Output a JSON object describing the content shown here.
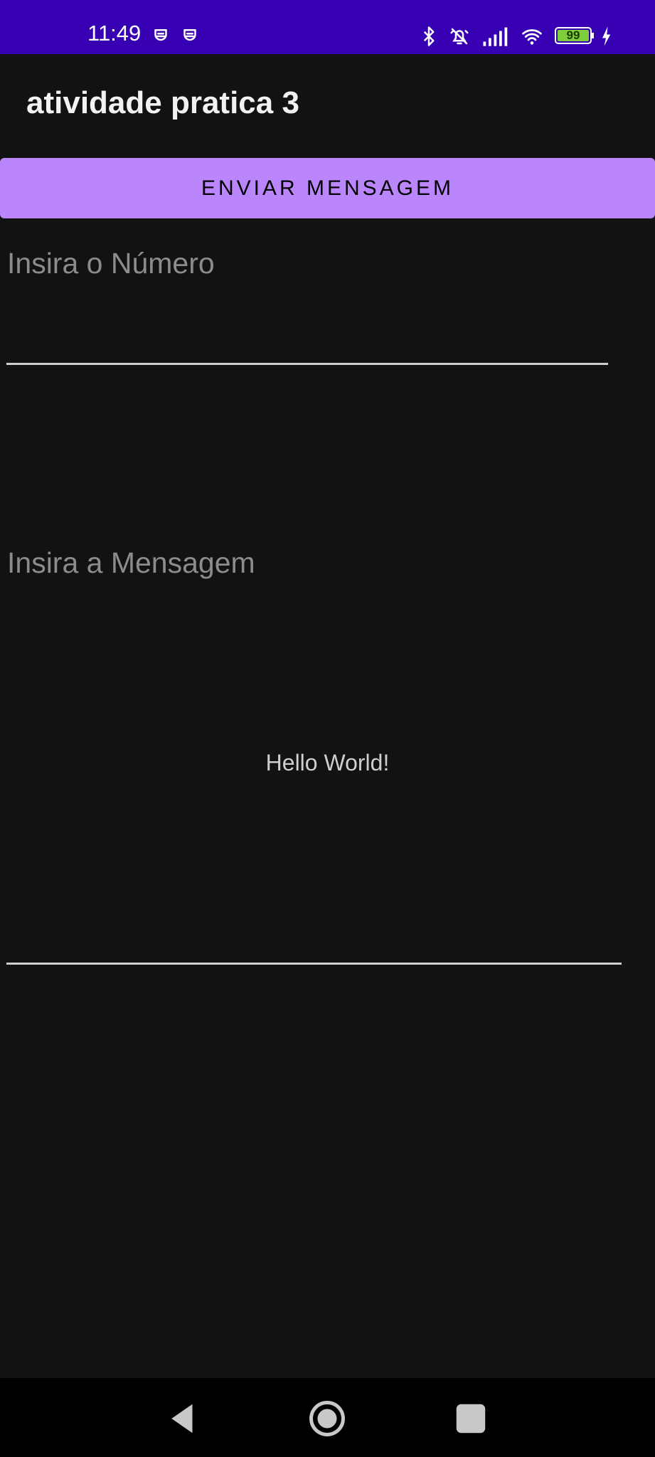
{
  "status_bar": {
    "time": "11:49",
    "battery_level": "99",
    "icons": [
      "notification-icon",
      "notification-icon",
      "bluetooth-icon",
      "alarm-off-icon",
      "signal-icon",
      "wifi-icon",
      "battery-icon",
      "charging-icon"
    ],
    "background_color": "#3700b3",
    "battery_color": "#7ecf3b"
  },
  "app_bar": {
    "title": "atividade pratica 3"
  },
  "main": {
    "send_button_label": "ENVIAR MENSAGEM",
    "number_field": {
      "placeholder": "Insira o Número",
      "value": ""
    },
    "message_field": {
      "placeholder": "Insira a Mensagem",
      "value": ""
    },
    "hello_text": "Hello World!"
  },
  "nav_bar": {
    "items": [
      "back-icon",
      "home-icon",
      "recents-icon"
    ]
  },
  "colors": {
    "accent": "#bb86fc",
    "background": "#121212"
  }
}
